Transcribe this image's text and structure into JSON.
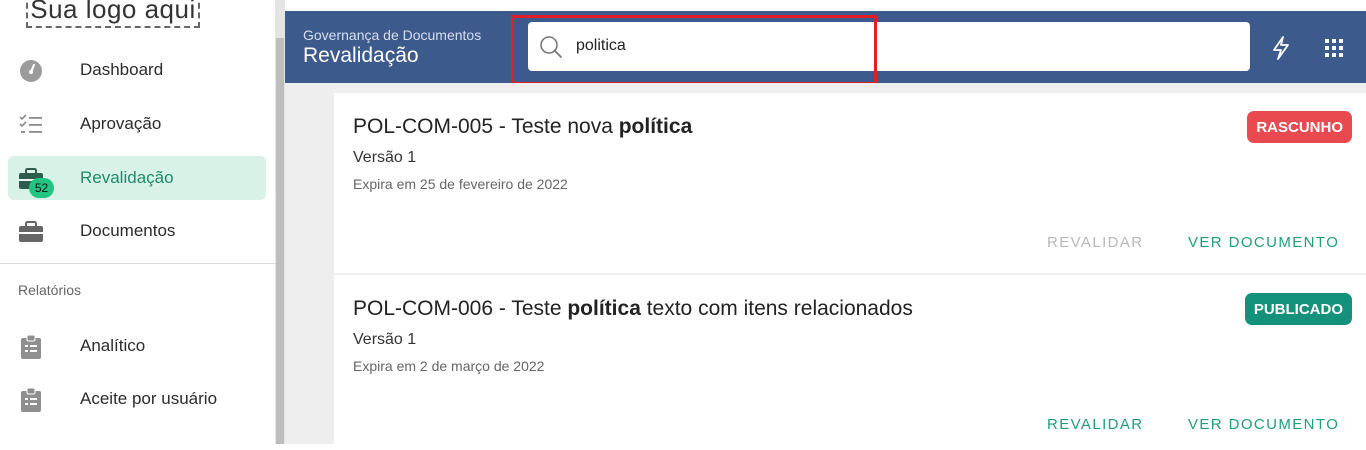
{
  "logo": {
    "text": "Sua logo aqui"
  },
  "sidebar": {
    "items": [
      {
        "label": "Dashboard",
        "icon": "speedometer-icon"
      },
      {
        "label": "Aprovação",
        "icon": "checklist-icon"
      },
      {
        "label": "Revalidação",
        "icon": "briefcase-icon",
        "badge": "52",
        "active": true
      },
      {
        "label": "Documentos",
        "icon": "briefcase-icon"
      }
    ],
    "section_title": "Relatórios",
    "report_items": [
      {
        "label": "Analítico",
        "icon": "clipboard-icon"
      },
      {
        "label": "Aceite por usuário",
        "icon": "clipboard-icon"
      }
    ]
  },
  "header": {
    "subtitle": "Governança de Documentos",
    "title": "Revalidação",
    "search_value": "politica",
    "icons": [
      "lightning-icon",
      "apps-grid-icon"
    ]
  },
  "documents": [
    {
      "title_prefix": "POL-COM-005 - Teste nova ",
      "title_bold": "política",
      "title_suffix": "",
      "version": "Versão 1",
      "expires": "Expira em 25 de fevereiro de 2022",
      "status": "RASCUNHO",
      "revalidate_label": "REVALIDAR",
      "revalidate_enabled": false,
      "view_label": "VER DOCUMENTO"
    },
    {
      "title_prefix": "POL-COM-006 - Teste ",
      "title_bold": "política",
      "title_suffix": " texto com itens relacionados",
      "version": "Versão 1",
      "expires": "Expira em 2 de março de 2022",
      "status": "PUBLICADO",
      "revalidate_label": "REVALIDAR",
      "revalidate_enabled": true,
      "view_label": "VER DOCUMENTO"
    }
  ],
  "colors": {
    "header_bg": "#3d5a8c",
    "accent_green": "#1f9e7a",
    "status_draft": "#e84a4f",
    "status_published": "#13917a",
    "active_bg": "#d9f2e8"
  }
}
